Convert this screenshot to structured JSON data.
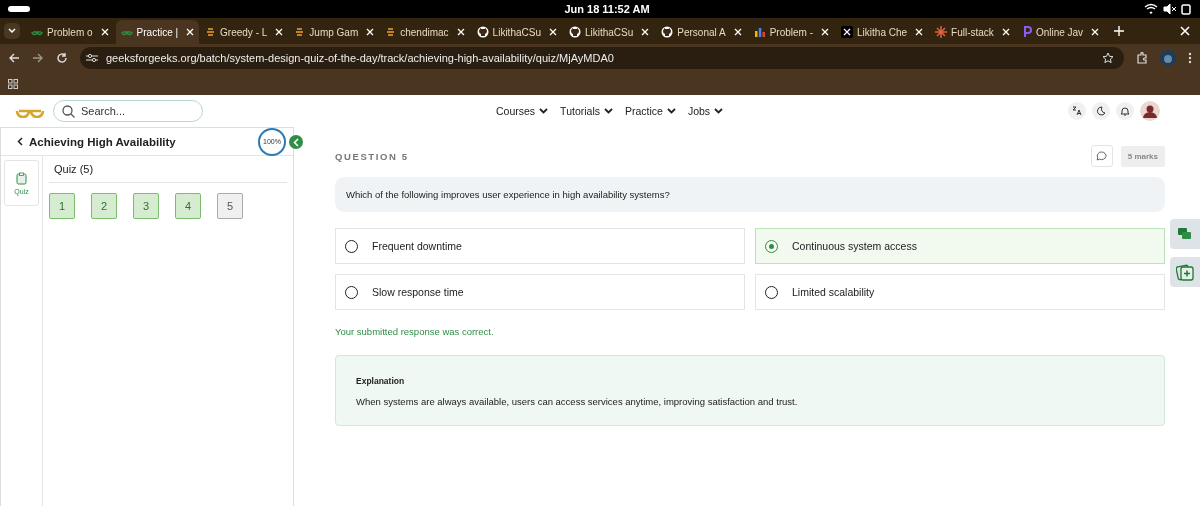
{
  "status_bar": {
    "clock": "Jun 18  11:52 AM"
  },
  "browser_tabs": [
    {
      "title": "Problem o",
      "kind": "gfg",
      "selected": false
    },
    {
      "title": "Practice |",
      "kind": "gfg",
      "selected": true
    },
    {
      "title": "Greedy - L",
      "kind": "slash",
      "selected": false
    },
    {
      "title": "Jump Gam",
      "kind": "slash",
      "selected": false
    },
    {
      "title": "chendimac",
      "kind": "slash",
      "selected": false
    },
    {
      "title": "LikithaCSu",
      "kind": "github",
      "selected": false
    },
    {
      "title": "LikithaCSu",
      "kind": "github",
      "selected": false
    },
    {
      "title": "Personal A",
      "kind": "github",
      "selected": false
    },
    {
      "title": "Problem -",
      "kind": "bars",
      "selected": false
    },
    {
      "title": "Likitha Che",
      "kind": "x",
      "selected": false
    },
    {
      "title": "Full-stack",
      "kind": "star",
      "selected": false
    },
    {
      "title": "Online Jav",
      "kind": "p",
      "selected": false
    }
  ],
  "address_bar": {
    "url": "geeksforgeeks.org/batch/system-design-quiz-of-the-day/track/achieving-high-availability/quiz/MjAyMDA0"
  },
  "header": {
    "search": {
      "placeholder": "Search..."
    },
    "nav": [
      "Courses",
      "Tutorials",
      "Practice",
      "Jobs"
    ]
  },
  "sidebar": {
    "title": "Achieving High Availability",
    "progress": "100%",
    "rail_item": "Quiz",
    "section": "Quiz (5)",
    "questions": [
      {
        "number": "1",
        "answered": true
      },
      {
        "number": "2",
        "answered": true
      },
      {
        "number": "3",
        "answered": true
      },
      {
        "number": "4",
        "answered": true
      },
      {
        "number": "5",
        "answered": false
      }
    ]
  },
  "question": {
    "heading": "QUESTION 5",
    "marks": "5 marks",
    "text": "Which of the following improves user experience in high availability systems?",
    "options": [
      {
        "label": "Frequent downtime",
        "selected": false
      },
      {
        "label": "Continuous system access",
        "selected": true
      },
      {
        "label": "Slow response time",
        "selected": false
      },
      {
        "label": "Limited scalability",
        "selected": false
      }
    ],
    "result": "Your submitted response was correct.",
    "explanation": {
      "title": "Explanation",
      "text": "When systems are always available, users can access services anytime, improving satisfaction and trust."
    }
  }
}
